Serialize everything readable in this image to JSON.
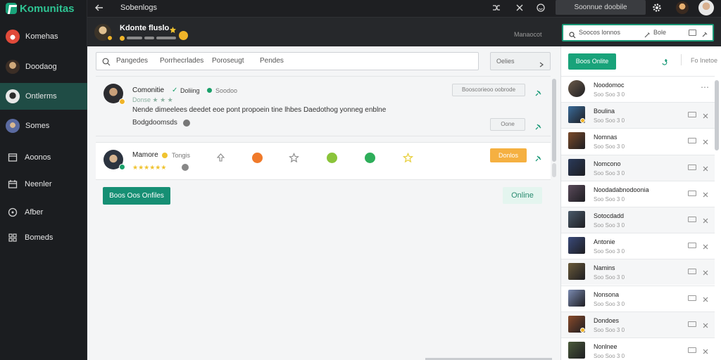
{
  "app": {
    "name": "Komunitas",
    "brand_color": "#19a37a"
  },
  "sidebar": {
    "items": [
      {
        "label": "Komehas",
        "kind": "avatar",
        "color": "#e04a3a"
      },
      {
        "label": "Doodaog",
        "kind": "avatar",
        "color": "#cfa87a"
      },
      {
        "label": "Ontlerms",
        "kind": "avatar",
        "color": "#dcdcdc",
        "active": true
      },
      {
        "label": "Somes",
        "kind": "avatar",
        "color": "#5a6aa0"
      },
      {
        "label": "Aoonos",
        "kind": "icon",
        "icon": "window-icon"
      },
      {
        "label": "Neenler",
        "kind": "icon",
        "icon": "calendar-icon"
      },
      {
        "label": "Afber",
        "kind": "icon",
        "icon": "compass-icon"
      },
      {
        "label": "Bomeds",
        "kind": "icon",
        "icon": "grid-icon"
      }
    ]
  },
  "topbar": {
    "title": "Sobenlogs",
    "search_label": "Soonnue doobile"
  },
  "header": {
    "name": "Kdonte fluslo",
    "right_text": "Manaocot"
  },
  "filter": {
    "tabs": [
      "Pangedes",
      "Porrhecrlades",
      "Poroseugt",
      "Pendes"
    ],
    "dropdown_label": "Oelies"
  },
  "posts": [
    {
      "name": "Comonitie",
      "tag1": "Doliing",
      "tag2": "Soodoo",
      "meta": "Donse ★ ★ ★",
      "text": "Nende dimeelees deedet eoe pont propoein tine lhbes Daedothog yonneg enblne",
      "tag": "Bodgdoomsds",
      "action_label": "Booscorieoo oobrode",
      "small_action_label": "Oone"
    },
    {
      "name": "Mamore",
      "tag1": "Tongis",
      "stars": "★★★★★★",
      "warn_label": "Donlos"
    }
  ],
  "main": {
    "primary_button": "Boos Oos Onfiles",
    "online_label": "Online"
  },
  "right_panel": {
    "search_text": "Soocos lonnos",
    "search_filter": "Bole",
    "button_label": "Boos Onlite",
    "head_text": "Fo Inetoe",
    "rows": [
      {
        "title": "Noodomoc",
        "sub": "Soo Soo 3 0",
        "thumb": "#6b5b4a",
        "round": true
      },
      {
        "title": "Boulina",
        "sub": "Soo Soo 3 0",
        "thumb": "#3a6b9a"
      },
      {
        "title": "Nomnas",
        "sub": "Soo Soo 3 0",
        "thumb": "#7a4a2a"
      },
      {
        "title": "Nomcono",
        "sub": "Soo Soo 3 0",
        "thumb": "#2a3a5a"
      },
      {
        "title": "Noodadabnodoonia",
        "sub": "Soo Soo 3 0",
        "thumb": "#5a4a5a"
      },
      {
        "title": "Sotocdadd",
        "sub": "Soo Soo 3 0",
        "thumb": "#4a5a6a"
      },
      {
        "title": "Antonie",
        "sub": "Soo Soo 3 0",
        "thumb": "#3a4a7a"
      },
      {
        "title": "Namins",
        "sub": "Soo Soo 3 0",
        "thumb": "#6a5a3a"
      },
      {
        "title": "Nonsona",
        "sub": "Soo Soo 3 0",
        "thumb": "#7a8ab0"
      },
      {
        "title": "Dondoes",
        "sub": "Soo Soo 3 0",
        "thumb": "#8a4a2a"
      },
      {
        "title": "Nonlnee",
        "sub": "Soo Soo 3 0",
        "thumb": "#4a5a3a"
      }
    ]
  }
}
